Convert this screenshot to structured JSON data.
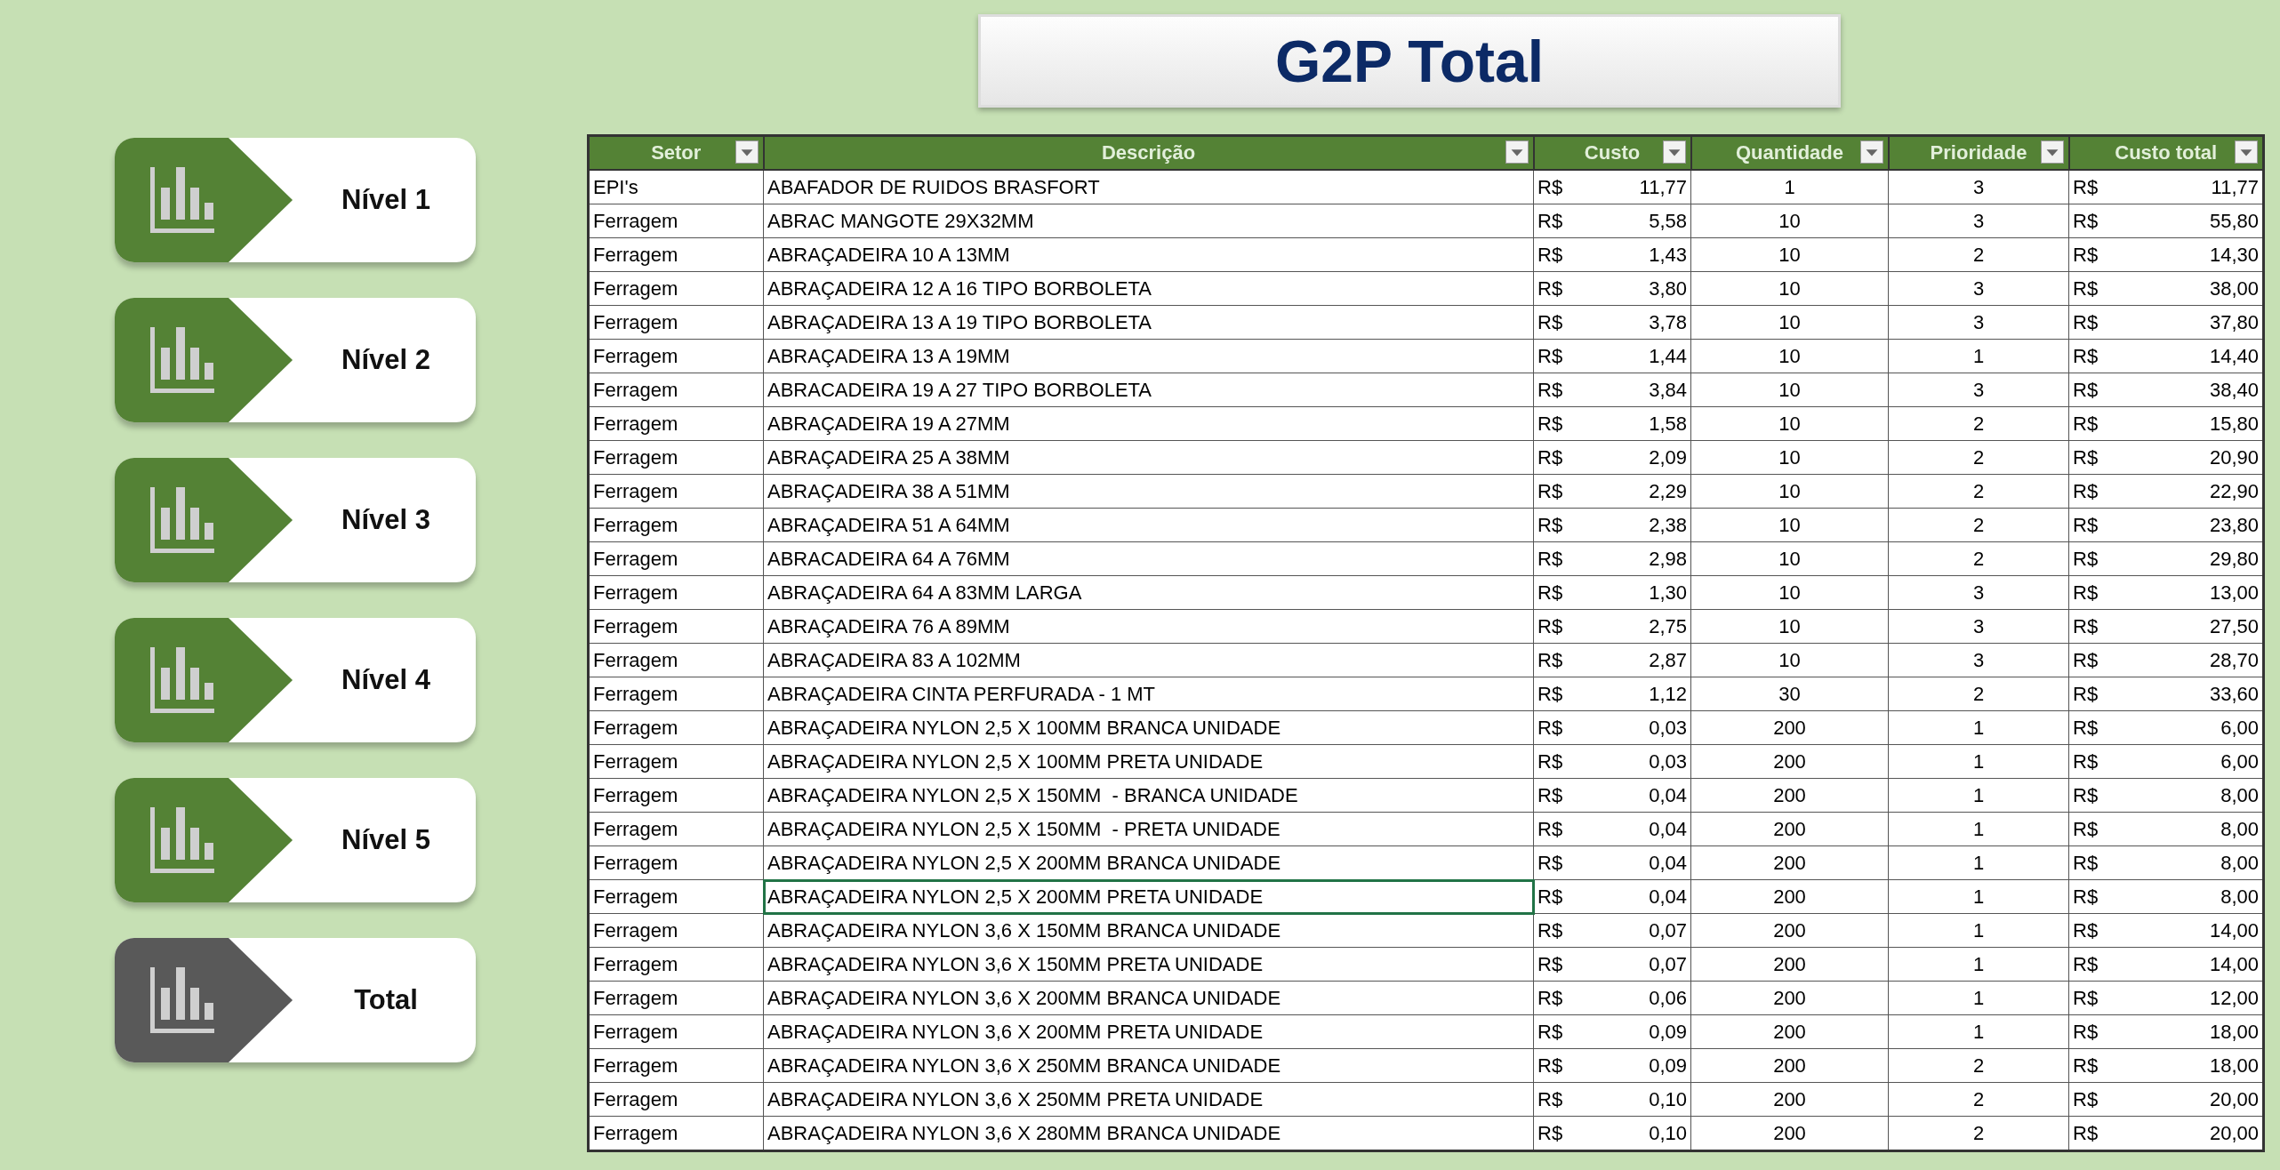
{
  "title": "G2P Total",
  "nav": [
    {
      "label": "Nível 1",
      "selected": false
    },
    {
      "label": "Nível 2",
      "selected": false
    },
    {
      "label": "Nível 3",
      "selected": false
    },
    {
      "label": "Nível 4",
      "selected": false
    },
    {
      "label": "Nível 5",
      "selected": false
    },
    {
      "label": "Total",
      "selected": true
    }
  ],
  "table": {
    "columns": [
      "Setor",
      "Descrição",
      "Custo",
      "Quantidade",
      "Prioridade",
      "Custo total"
    ],
    "rows": [
      {
        "setor": "EPI's",
        "descricao": "ABAFADOR DE RUIDOS BRASFORT",
        "custo_currency": "R$",
        "custo": "11,77",
        "quantidade": "1",
        "prioridade": "3",
        "total_currency": "R$",
        "total": "11,77",
        "selected": false
      },
      {
        "setor": "Ferragem",
        "descricao": "ABRAC MANGOTE 29X32MM",
        "custo_currency": "R$",
        "custo": "5,58",
        "quantidade": "10",
        "prioridade": "3",
        "total_currency": "R$",
        "total": "55,80",
        "selected": false
      },
      {
        "setor": "Ferragem",
        "descricao": "ABRAÇADEIRA 10 A 13MM",
        "custo_currency": "R$",
        "custo": "1,43",
        "quantidade": "10",
        "prioridade": "2",
        "total_currency": "R$",
        "total": "14,30",
        "selected": false
      },
      {
        "setor": "Ferragem",
        "descricao": "ABRAÇADEIRA 12 A 16 TIPO BORBOLETA",
        "custo_currency": "R$",
        "custo": "3,80",
        "quantidade": "10",
        "prioridade": "3",
        "total_currency": "R$",
        "total": "38,00",
        "selected": false
      },
      {
        "setor": "Ferragem",
        "descricao": "ABRAÇADEIRA 13 A 19 TIPO BORBOLETA",
        "custo_currency": "R$",
        "custo": "3,78",
        "quantidade": "10",
        "prioridade": "3",
        "total_currency": "R$",
        "total": "37,80",
        "selected": false
      },
      {
        "setor": "Ferragem",
        "descricao": "ABRAÇADEIRA 13 A 19MM",
        "custo_currency": "R$",
        "custo": "1,44",
        "quantidade": "10",
        "prioridade": "1",
        "total_currency": "R$",
        "total": "14,40",
        "selected": false
      },
      {
        "setor": "Ferragem",
        "descricao": "ABRACADEIRA 19 A 27 TIPO BORBOLETA",
        "custo_currency": "R$",
        "custo": "3,84",
        "quantidade": "10",
        "prioridade": "3",
        "total_currency": "R$",
        "total": "38,40",
        "selected": false
      },
      {
        "setor": "Ferragem",
        "descricao": "ABRAÇADEIRA 19 A 27MM",
        "custo_currency": "R$",
        "custo": "1,58",
        "quantidade": "10",
        "prioridade": "2",
        "total_currency": "R$",
        "total": "15,80",
        "selected": false
      },
      {
        "setor": "Ferragem",
        "descricao": "ABRAÇADEIRA 25 A 38MM",
        "custo_currency": "R$",
        "custo": "2,09",
        "quantidade": "10",
        "prioridade": "2",
        "total_currency": "R$",
        "total": "20,90",
        "selected": false
      },
      {
        "setor": "Ferragem",
        "descricao": "ABRAÇADEIRA 38 A 51MM",
        "custo_currency": "R$",
        "custo": "2,29",
        "quantidade": "10",
        "prioridade": "2",
        "total_currency": "R$",
        "total": "22,90",
        "selected": false
      },
      {
        "setor": "Ferragem",
        "descricao": "ABRAÇADEIRA 51 A 64MM",
        "custo_currency": "R$",
        "custo": "2,38",
        "quantidade": "10",
        "prioridade": "2",
        "total_currency": "R$",
        "total": "23,80",
        "selected": false
      },
      {
        "setor": "Ferragem",
        "descricao": "ABRACADEIRA 64 A 76MM",
        "custo_currency": "R$",
        "custo": "2,98",
        "quantidade": "10",
        "prioridade": "2",
        "total_currency": "R$",
        "total": "29,80",
        "selected": false
      },
      {
        "setor": "Ferragem",
        "descricao": "ABRAÇADEIRA 64 A 83MM LARGA",
        "custo_currency": "R$",
        "custo": "1,30",
        "quantidade": "10",
        "prioridade": "3",
        "total_currency": "R$",
        "total": "13,00",
        "selected": false
      },
      {
        "setor": "Ferragem",
        "descricao": "ABRAÇADEIRA 76 A 89MM",
        "custo_currency": "R$",
        "custo": "2,75",
        "quantidade": "10",
        "prioridade": "3",
        "total_currency": "R$",
        "total": "27,50",
        "selected": false
      },
      {
        "setor": "Ferragem",
        "descricao": "ABRAÇADEIRA 83 A 102MM",
        "custo_currency": "R$",
        "custo": "2,87",
        "quantidade": "10",
        "prioridade": "3",
        "total_currency": "R$",
        "total": "28,70",
        "selected": false
      },
      {
        "setor": "Ferragem",
        "descricao": "ABRAÇADEIRA CINTA PERFURADA - 1 MT",
        "custo_currency": "R$",
        "custo": "1,12",
        "quantidade": "30",
        "prioridade": "2",
        "total_currency": "R$",
        "total": "33,60",
        "selected": false
      },
      {
        "setor": "Ferragem",
        "descricao": "ABRAÇADEIRA NYLON 2,5 X 100MM BRANCA UNIDADE",
        "custo_currency": "R$",
        "custo": "0,03",
        "quantidade": "200",
        "prioridade": "1",
        "total_currency": "R$",
        "total": "6,00",
        "selected": false
      },
      {
        "setor": "Ferragem",
        "descricao": "ABRAÇADEIRA NYLON 2,5 X 100MM PRETA UNIDADE",
        "custo_currency": "R$",
        "custo": "0,03",
        "quantidade": "200",
        "prioridade": "1",
        "total_currency": "R$",
        "total": "6,00",
        "selected": false
      },
      {
        "setor": "Ferragem",
        "descricao": "ABRAÇADEIRA NYLON 2,5 X 150MM  - BRANCA UNIDADE",
        "custo_currency": "R$",
        "custo": "0,04",
        "quantidade": "200",
        "prioridade": "1",
        "total_currency": "R$",
        "total": "8,00",
        "selected": false
      },
      {
        "setor": "Ferragem",
        "descricao": "ABRAÇADEIRA NYLON 2,5 X 150MM  - PRETA UNIDADE",
        "custo_currency": "R$",
        "custo": "0,04",
        "quantidade": "200",
        "prioridade": "1",
        "total_currency": "R$",
        "total": "8,00",
        "selected": false
      },
      {
        "setor": "Ferragem",
        "descricao": "ABRAÇADEIRA NYLON 2,5 X 200MM BRANCA UNIDADE",
        "custo_currency": "R$",
        "custo": "0,04",
        "quantidade": "200",
        "prioridade": "1",
        "total_currency": "R$",
        "total": "8,00",
        "selected": false
      },
      {
        "setor": "Ferragem",
        "descricao": "ABRAÇADEIRA NYLON 2,5 X 200MM PRETA UNIDADE",
        "custo_currency": "R$",
        "custo": "0,04",
        "quantidade": "200",
        "prioridade": "1",
        "total_currency": "R$",
        "total": "8,00",
        "selected": true
      },
      {
        "setor": "Ferragem",
        "descricao": "ABRAÇADEIRA NYLON 3,6 X 150MM BRANCA UNIDADE",
        "custo_currency": "R$",
        "custo": "0,07",
        "quantidade": "200",
        "prioridade": "1",
        "total_currency": "R$",
        "total": "14,00",
        "selected": false
      },
      {
        "setor": "Ferragem",
        "descricao": "ABRAÇADEIRA NYLON 3,6 X 150MM PRETA UNIDADE",
        "custo_currency": "R$",
        "custo": "0,07",
        "quantidade": "200",
        "prioridade": "1",
        "total_currency": "R$",
        "total": "14,00",
        "selected": false
      },
      {
        "setor": "Ferragem",
        "descricao": "ABRAÇADEIRA NYLON 3,6 X 200MM BRANCA UNIDADE",
        "custo_currency": "R$",
        "custo": "0,06",
        "quantidade": "200",
        "prioridade": "1",
        "total_currency": "R$",
        "total": "12,00",
        "selected": false
      },
      {
        "setor": "Ferragem",
        "descricao": "ABRAÇADEIRA NYLON 3,6 X 200MM PRETA UNIDADE",
        "custo_currency": "R$",
        "custo": "0,09",
        "quantidade": "200",
        "prioridade": "1",
        "total_currency": "R$",
        "total": "18,00",
        "selected": false
      },
      {
        "setor": "Ferragem",
        "descricao": "ABRAÇADEIRA NYLON 3,6 X 250MM BRANCA UNIDADE",
        "custo_currency": "R$",
        "custo": "0,09",
        "quantidade": "200",
        "prioridade": "2",
        "total_currency": "R$",
        "total": "18,00",
        "selected": false
      },
      {
        "setor": "Ferragem",
        "descricao": "ABRAÇADEIRA NYLON 3,6 X 250MM PRETA UNIDADE",
        "custo_currency": "R$",
        "custo": "0,10",
        "quantidade": "200",
        "prioridade": "2",
        "total_currency": "R$",
        "total": "20,00",
        "selected": false
      },
      {
        "setor": "Ferragem",
        "descricao": "ABRAÇADEIRA NYLON 3,6 X 280MM BRANCA UNIDADE",
        "custo_currency": "R$",
        "custo": "0,10",
        "quantidade": "200",
        "prioridade": "2",
        "total_currency": "R$",
        "total": "20,00",
        "selected": false
      }
    ]
  }
}
